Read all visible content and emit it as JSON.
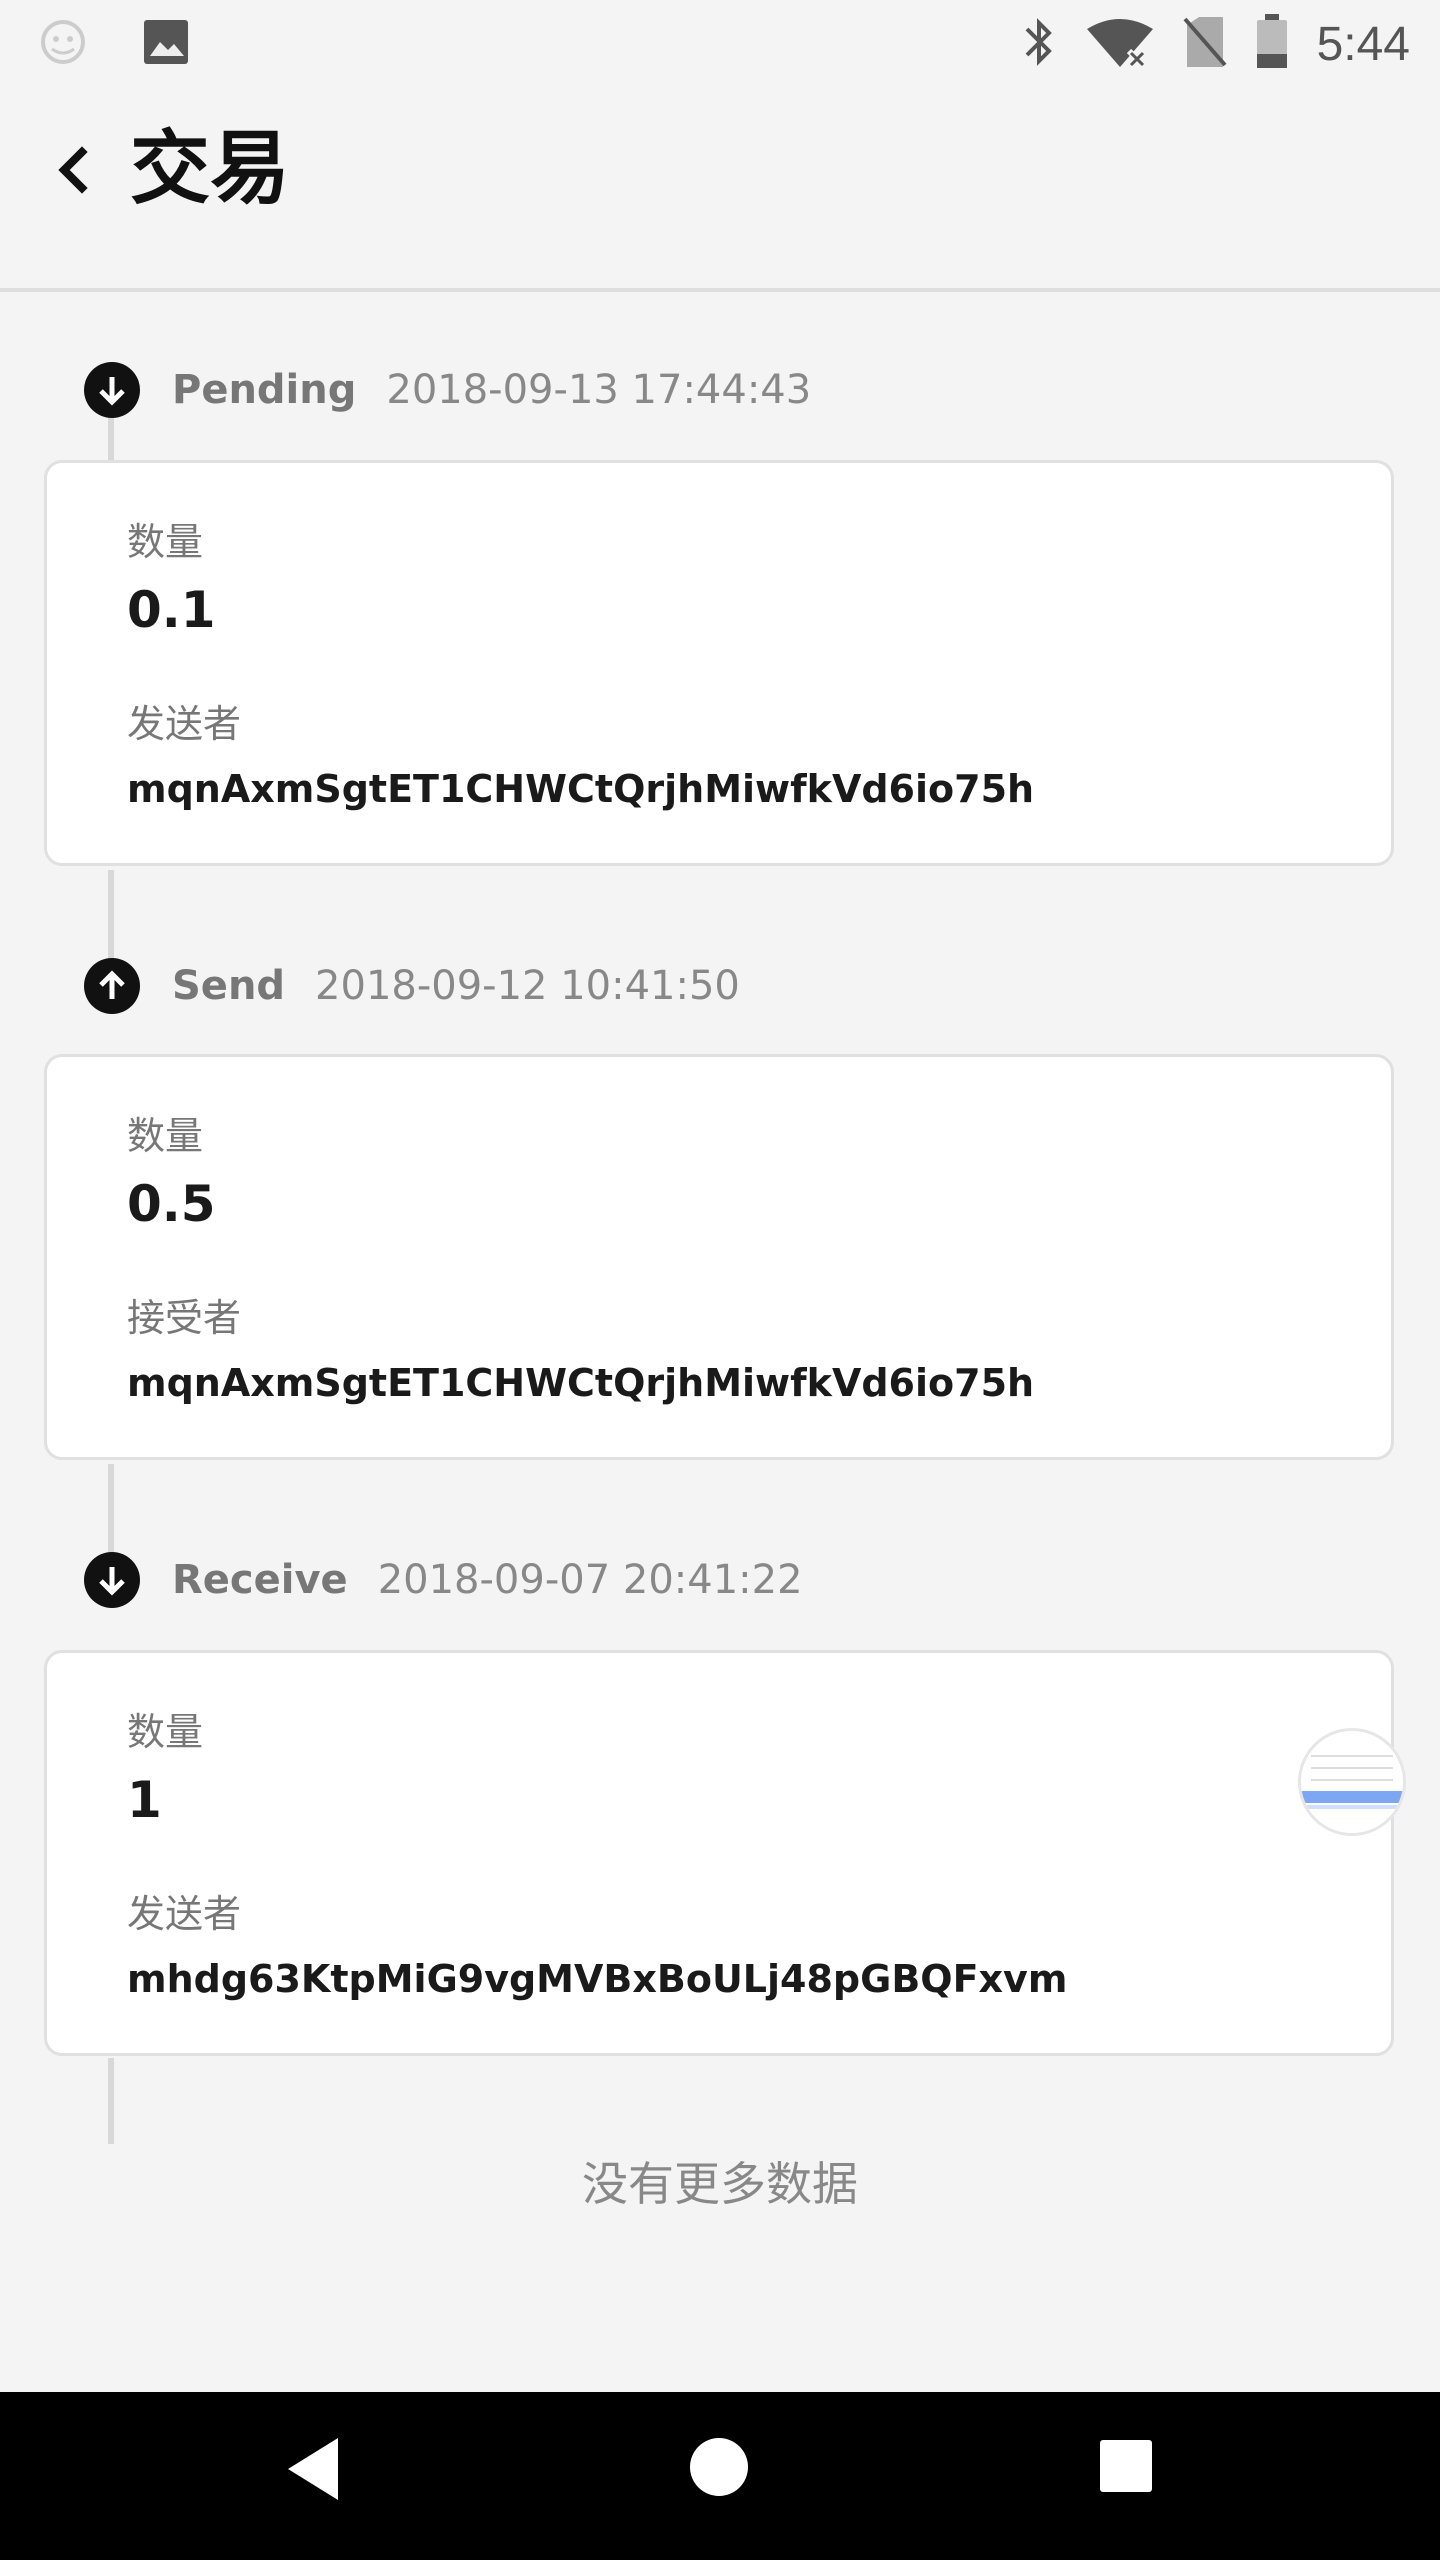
{
  "status_bar": {
    "time": "5:44",
    "left_icons": [
      "android-debug-icon",
      "image-icon"
    ],
    "right_icons": [
      "bluetooth-icon",
      "wifi-off-icon",
      "no-sim-icon",
      "battery-icon"
    ]
  },
  "header": {
    "title": "交易",
    "back_icon": "chevron-left-icon"
  },
  "transactions": [
    {
      "type": "Pending",
      "direction_icon": "arrow-down-circle-icon",
      "timestamp": "2018-09-13 17:44:43",
      "amount_label": "数量",
      "amount": "0.1",
      "party_label": "发送者",
      "address": "mqnAxmSgtET1CHWCtQrjhMiwfkVd6io75h"
    },
    {
      "type": "Send",
      "direction_icon": "arrow-up-circle-icon",
      "timestamp": "2018-09-12 10:41:50",
      "amount_label": "数量",
      "amount": "0.5",
      "party_label": "接受者",
      "address": "mqnAxmSgtET1CHWCtQrjhMiwfkVd6io75h"
    },
    {
      "type": "Receive",
      "direction_icon": "arrow-down-circle-icon",
      "timestamp": "2018-09-07 20:41:22",
      "amount_label": "数量",
      "amount": "1",
      "party_label": "发送者",
      "address": "mhdg63KtpMiG9vgMVBxBoULj48pGBQFxvm"
    }
  ],
  "footer": {
    "no_more_text": "没有更多数据"
  },
  "nav_bar": {
    "buttons": [
      "nav-back-icon",
      "nav-home-icon",
      "nav-recents-icon"
    ]
  },
  "colors": {
    "background": "#f4f4f4",
    "card": "#ffffff",
    "icon_dark": "#111111",
    "muted_text": "#777777"
  }
}
